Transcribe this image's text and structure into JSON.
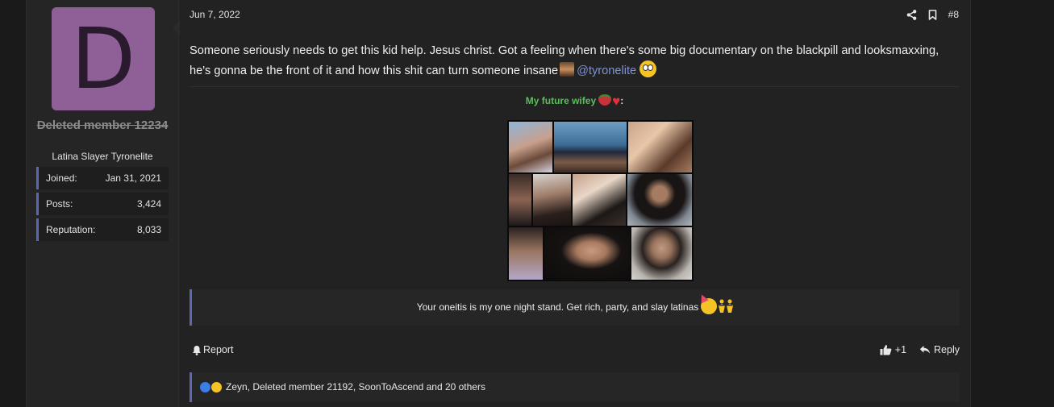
{
  "user": {
    "avatar_letter": "D",
    "username": "Deleted member 12234",
    "user_title": "Latina Slayer Tyronelite",
    "stats": [
      {
        "label": "Joined:",
        "value": "Jan 31, 2021"
      },
      {
        "label": "Posts:",
        "value": "3,424"
      },
      {
        "label": "Reputation:",
        "value": "8,033"
      }
    ],
    "avatar_color": "#8f5f98"
  },
  "post": {
    "date": "Jun 7, 2022",
    "post_number": "#8",
    "message_text": "Someone seriously needs to get this kid help. Jesus christ. Got a feeling when there's some big documentary on the blackpill and looksmaxxing, he's gonna be the front of it and how this shit can turn someone insane",
    "mention": "@tyronelite",
    "signature": {
      "heading": "My future wifey",
      "heading_suffix": ":",
      "quote": "Your oneitis is my one night stand. Get rich, party, and slay latinas"
    }
  },
  "footer": {
    "report_label": "Report",
    "like_count": "+1",
    "reply_label": "Reply"
  },
  "reactions": {
    "text": "Zeyn, Deleted member 21192, SoonToAscend and 20 others"
  },
  "colors": {
    "accent": "#5a68b5",
    "mention": "#7f93d6",
    "signature_green": "#5bbf5b"
  }
}
